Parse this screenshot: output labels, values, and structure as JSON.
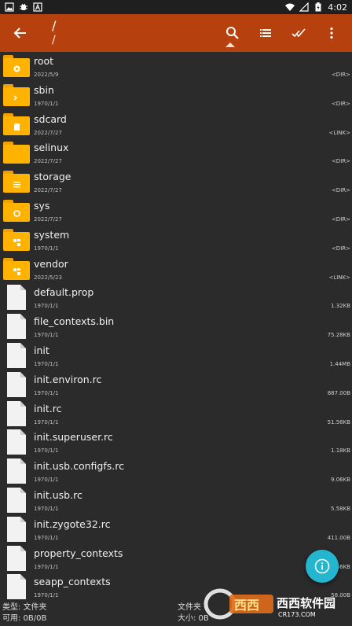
{
  "status_bar": {
    "time": "4:02"
  },
  "toolbar": {
    "path_line1": "/",
    "path_line2": "/"
  },
  "files": [
    {
      "name": "root",
      "date": "2022/5/9",
      "meta": "<DIR>",
      "type": "folder",
      "emblem": "gear"
    },
    {
      "name": "sbin",
      "date": "1970/1/1",
      "meta": "<DIR>",
      "type": "folder",
      "emblem": "terminal"
    },
    {
      "name": "sdcard",
      "date": "2022/7/27",
      "meta": "<LINK>",
      "type": "folder",
      "emblem": "sd"
    },
    {
      "name": "selinux",
      "date": "2022/7/27",
      "meta": "<DIR>",
      "type": "folder",
      "emblem": ""
    },
    {
      "name": "storage",
      "date": "2022/7/27",
      "meta": "<DIR>",
      "type": "folder",
      "emblem": "list"
    },
    {
      "name": "sys",
      "date": "2022/7/27",
      "meta": "<DIR>",
      "type": "folder",
      "emblem": "settings"
    },
    {
      "name": "system",
      "date": "1970/1/1",
      "meta": "<DIR>",
      "type": "folder",
      "emblem": "nodes"
    },
    {
      "name": "vendor",
      "date": "2022/5/23",
      "meta": "<LINK>",
      "type": "folder",
      "emblem": "nodes"
    },
    {
      "name": "default.prop",
      "date": "1970/1/1",
      "meta": "1.32KB",
      "type": "file"
    },
    {
      "name": "file_contexts.bin",
      "date": "1970/1/1",
      "meta": "75.28KB",
      "type": "file"
    },
    {
      "name": "init",
      "date": "1970/1/1",
      "meta": "1.44MB",
      "type": "file"
    },
    {
      "name": "init.environ.rc",
      "date": "1970/1/1",
      "meta": "887.00B",
      "type": "file"
    },
    {
      "name": "init.rc",
      "date": "1970/1/1",
      "meta": "51.56KB",
      "type": "file"
    },
    {
      "name": "init.superuser.rc",
      "date": "1970/1/1",
      "meta": "1.18KB",
      "type": "file"
    },
    {
      "name": "init.usb.configfs.rc",
      "date": "1970/1/1",
      "meta": "9.06KB",
      "type": "file"
    },
    {
      "name": "init.usb.rc",
      "date": "1970/1/1",
      "meta": "5.58KB",
      "type": "file"
    },
    {
      "name": "init.zygote32.rc",
      "date": "1970/1/1",
      "meta": "411.00B",
      "type": "file"
    },
    {
      "name": "property_contexts",
      "date": "1970/1/1",
      "meta": "56KB",
      "type": "file"
    },
    {
      "name": "seapp_contexts",
      "date": "1970/1/1",
      "meta": "58.00B",
      "type": "file"
    }
  ],
  "footer": {
    "type_label": "类型: 文件夹",
    "avail_label": "可用: 0B/0B",
    "right_type_label": "文件夹",
    "size_label": "大小: 0B"
  },
  "watermark": {
    "text": "西西软件园",
    "url": "CR173.COM"
  },
  "colors": {
    "toolbar": "#b7410e",
    "folder": "#ffb300",
    "fab": "#24b5cf",
    "background": "#2b2b2b"
  }
}
